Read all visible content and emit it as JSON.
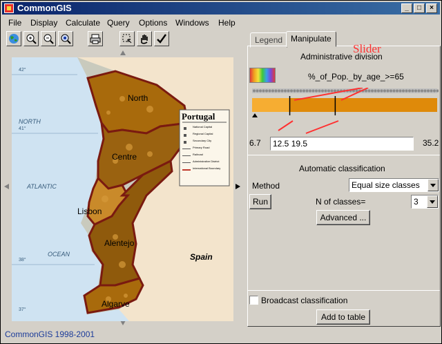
{
  "window": {
    "title": "CommonGIS"
  },
  "menu": [
    "File",
    "Display",
    "Calculate",
    "Query",
    "Options",
    "Windows",
    "Help"
  ],
  "toolbar": [
    "world-icon",
    "zoom-in-icon",
    "zoom-out-icon",
    "zoom-select-icon",
    "print-icon",
    "select-rect-icon",
    "hand-icon",
    "check-icon"
  ],
  "map": {
    "title": "Portugal",
    "labels": {
      "north": "North",
      "centre": "Centre",
      "lisbon": "Lisbon",
      "alentejo": "Alentejo",
      "algarve": "Algarve",
      "spain": "Spain",
      "ocean_north": "NORTH",
      "ocean_atlantic": "ATLANTIC",
      "ocean_ocean": "OCEAN",
      "lat_42": "42°",
      "lat_41": "41°",
      "lat_38": "38°",
      "lat_37": "37°"
    },
    "legend_box_lines": [
      "National Capital",
      "Regional Capital",
      "Secondary City",
      "Primary Road",
      "Railroad",
      "Administrative District",
      "International Boundary"
    ]
  },
  "status_text": "CommonGIS 1998-2001",
  "panel": {
    "tabs": [
      "Legend",
      "Manipulate"
    ],
    "active_tab": "Manipulate",
    "layer_name": "Administrative division",
    "attribute": "%_of_Pop._by_age_>=65",
    "annotation": "Slider",
    "slider": {
      "min": 6.7,
      "max": 35.2,
      "min_label": "6.7",
      "max_label": "35.2",
      "breaks_text": "12.5 19.5",
      "breaks": [
        12.5,
        19.5
      ],
      "class_colors": [
        "#f6ad32",
        "#df8a0a",
        "#c07a08"
      ]
    },
    "auto_class": {
      "heading": "Automatic classification",
      "method_label": "Method",
      "method_value": "Equal size classes",
      "run_label": "Run",
      "nclasses_label": "N of classes=",
      "nclasses_value": "3",
      "advanced_label": "Advanced ..."
    },
    "broadcast_label": "Broadcast classification",
    "broadcast_checked": false,
    "add_to_table_label": "Add to table"
  }
}
